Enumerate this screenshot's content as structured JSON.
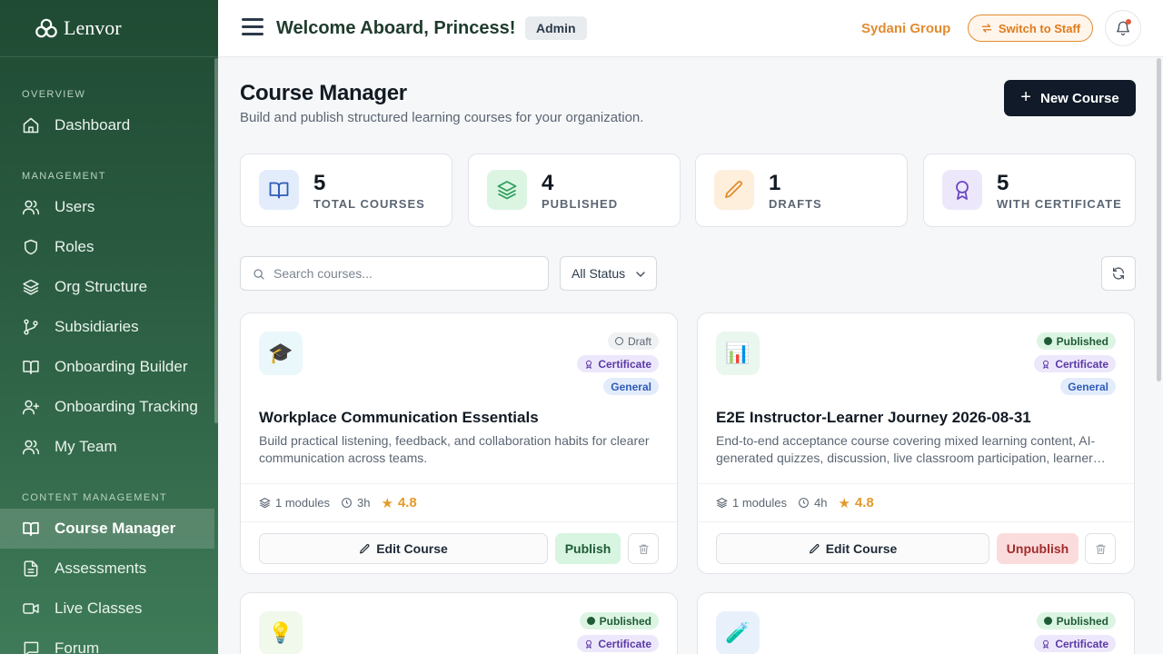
{
  "brand": {
    "name": "Lenvor"
  },
  "sidebar": {
    "sections": [
      {
        "title": "Overview"
      },
      {
        "title": "Management"
      },
      {
        "title": "Content Management"
      }
    ],
    "items": [
      {
        "label": "Dashboard",
        "icon": "home-icon"
      },
      {
        "label": "Users",
        "icon": "users-icon"
      },
      {
        "label": "Roles",
        "icon": "shield-icon"
      },
      {
        "label": "Org Structure",
        "icon": "layers-icon"
      },
      {
        "label": "Subsidiaries",
        "icon": "git-branch-icon"
      },
      {
        "label": "Onboarding Builder",
        "icon": "book-open-icon"
      },
      {
        "label": "Onboarding Tracking",
        "icon": "user-plus-icon"
      },
      {
        "label": "My Team",
        "icon": "users-icon"
      },
      {
        "label": "Course Manager",
        "icon": "book-open-icon",
        "active": true
      },
      {
        "label": "Assessments",
        "icon": "file-text-icon"
      },
      {
        "label": "Live Classes",
        "icon": "video-icon"
      },
      {
        "label": "Forum",
        "icon": "message-icon"
      }
    ]
  },
  "topbar": {
    "welcome": "Welcome Aboard, Princess!",
    "role": "Admin",
    "org": "Sydani Group",
    "switch_label": "Switch to Staff"
  },
  "page": {
    "title": "Course Manager",
    "subtitle": "Build and publish structured learning courses for your organization.",
    "new_button": "New Course"
  },
  "stats": [
    {
      "value": "5",
      "label": "Total Courses",
      "color": "#2f5bb8",
      "bg": "#e3ecfb"
    },
    {
      "value": "4",
      "label": "Published",
      "color": "#2e9e5b",
      "bg": "#dcf5e3"
    },
    {
      "value": "1",
      "label": "Drafts",
      "color": "#e38b2f",
      "bg": "#fdefdc"
    },
    {
      "value": "5",
      "label": "With Certificate",
      "color": "#6b46c1",
      "bg": "#ede7fb"
    }
  ],
  "filters": {
    "search_placeholder": "Search courses...",
    "status_value": "All Status"
  },
  "courses": [
    {
      "emoji": "🎓",
      "thumb_bg": "#eaf8fb",
      "status": "Draft",
      "certificate": "Certificate",
      "category": "General",
      "title": "Workplace Communication Essentials",
      "description": "Build practical listening, feedback, and collaboration habits for clearer communication across teams.",
      "modules": "1 modules",
      "duration": "3h",
      "rating": "4.8",
      "edit_label": "Edit Course",
      "toggle_label": "Publish"
    },
    {
      "emoji": "📊",
      "thumb_bg": "#eaf7ee",
      "status": "Published",
      "certificate": "Certificate",
      "category": "General",
      "title": "E2E Instructor-Learner Journey 2026-08-31",
      "description": "End-to-end acceptance course covering mixed learning content, AI-generated quizzes, discussion, live classroom participation, learner…",
      "modules": "1 modules",
      "duration": "4h",
      "rating": "4.8",
      "edit_label": "Edit Course",
      "toggle_label": "Unpublish"
    },
    {
      "emoji": "💡",
      "thumb_bg": "#f1f8ec",
      "status": "Published",
      "certificate": "Certificate"
    },
    {
      "emoji": "🧪",
      "thumb_bg": "#e8f1fb",
      "status": "Published",
      "certificate": "Certificate"
    }
  ]
}
